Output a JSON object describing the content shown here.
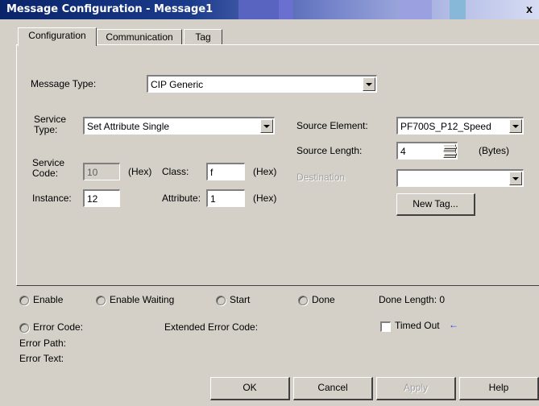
{
  "window": {
    "title": "Message Configuration - Message1",
    "close_glyph": "x",
    "title_accent_colors": [
      "#5864c0",
      "#6a70d0",
      "#9aa0e0",
      "#88b8d8",
      "#b8c0ec"
    ]
  },
  "tabs": [
    {
      "label": "Configuration",
      "active": true
    },
    {
      "label": "Communication",
      "active": false
    },
    {
      "label": "Tag",
      "active": false
    }
  ],
  "config": {
    "message_type_label": "Message Type:",
    "message_type_value": "CIP Generic",
    "service_type_label_1": "Service",
    "service_type_label_2": "Type:",
    "service_type_value": "Set Attribute Single",
    "service_code_label_1": "Service",
    "service_code_label_2": "Code:",
    "service_code_value": "10",
    "hex_label": "(Hex)",
    "class_label": "Class:",
    "class_value": "f",
    "instance_label": "Instance:",
    "instance_value": "12",
    "attribute_label": "Attribute:",
    "attribute_value": "1",
    "source_element_label": "Source Element:",
    "source_element_value": "PF700S_P12_Speed",
    "source_length_label": "Source Length:",
    "source_length_value": "4",
    "bytes_label": "(Bytes)",
    "destination_label": "Destination",
    "destination_value": "",
    "new_tag_button": "New Tag..."
  },
  "status": {
    "enable": "Enable",
    "enable_waiting": "Enable Waiting",
    "start": "Start",
    "done": "Done",
    "done_length": "Done Length: 0",
    "error_code": "Error Code:",
    "extended_error_code": "Extended Error Code:",
    "timed_out": "Timed Out",
    "error_path": "Error Path:",
    "error_text": "Error Text:"
  },
  "buttons": {
    "ok": "OK",
    "cancel": "Cancel",
    "apply": "Apply",
    "help": "Help"
  },
  "colors": {
    "title_bar_dark": "#0a246a",
    "dialog_bg": "#d4d0c8",
    "timed_out_arrow": "#1a3ae0"
  }
}
